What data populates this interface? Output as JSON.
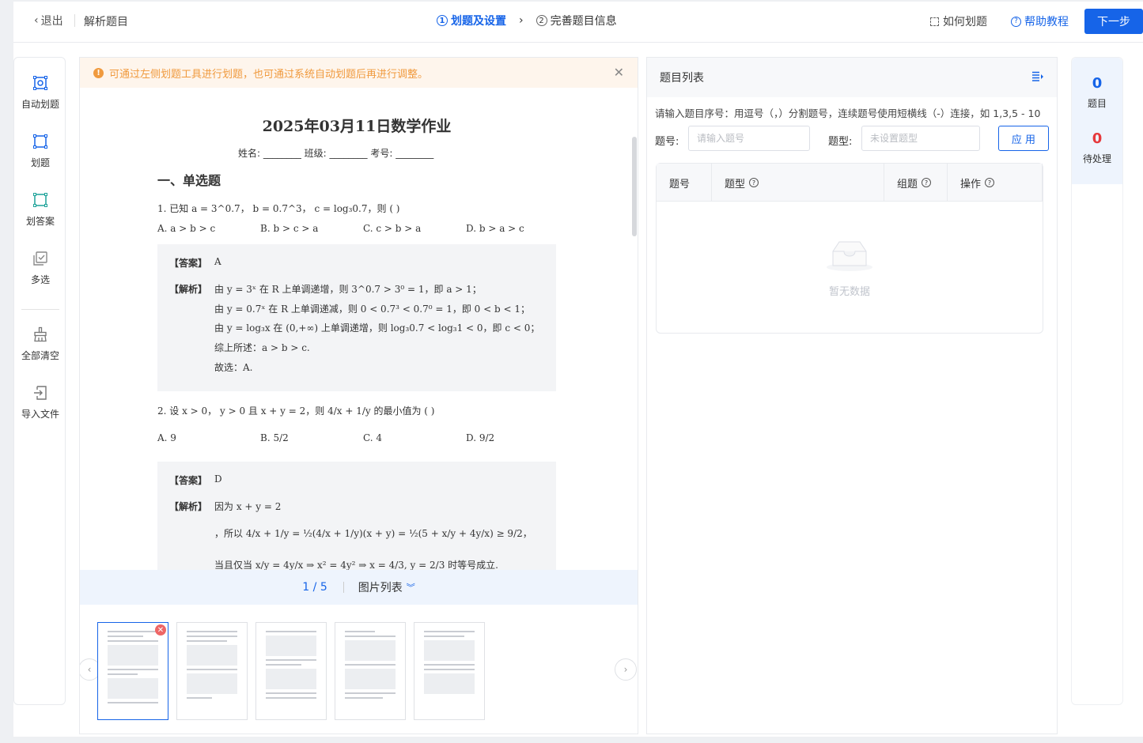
{
  "header": {
    "back_label": "退出",
    "title": "解析题目",
    "steps": [
      {
        "num": "1",
        "label": "划题及设置"
      },
      {
        "num": "2",
        "label": "完善题目信息"
      }
    ],
    "how_label": "如何划题",
    "help_label": "帮助教程",
    "next_label": "下一步"
  },
  "toolbar": {
    "items": [
      {
        "label": "自动划题",
        "icon": "auto-select-icon"
      },
      {
        "label": "划题",
        "icon": "select-question-icon"
      },
      {
        "label": "划答案",
        "icon": "select-answer-icon"
      },
      {
        "label": "多选",
        "icon": "multi-select-icon"
      },
      {
        "label": "全部清空",
        "icon": "broom-icon"
      },
      {
        "label": "导入文件",
        "icon": "import-icon"
      }
    ]
  },
  "notice": "可通过左侧划题工具进行划题，也可通过系统自动划题后再进行调整。",
  "document": {
    "title": "2025年03月11日数学作业",
    "fields": "姓名: ________  班级: ________  考号: ________",
    "section": "一、单选题",
    "q1": {
      "stem": "1. 已知 a = 3^0.7， b = 0.7^3， c = log₃0.7，则 ( )",
      "options": [
        "A. a > b > c",
        "B. b > c > a",
        "C. c > b > a",
        "D. b > a > c"
      ],
      "answer_label": "【答案】",
      "answer": "A",
      "analysis_label": "【解析】",
      "analysis": [
        "由 y = 3ˣ 在 R 上单调递增，则 3^0.7 > 3⁰ = 1，即 a > 1；",
        "由 y = 0.7ˣ 在 R 上单调递减，则 0 < 0.7³ < 0.7⁰ = 1，即 0 < b < 1；",
        "由 y = log₃x 在 (0,+∞) 上单调递增，则 log₃0.7 < log₃1 < 0，即 c < 0；",
        "综上所述：a > b > c.",
        "故选：A."
      ]
    },
    "q2": {
      "stem": "2. 设 x > 0， y > 0 且 x + y = 2，则 4/x + 1/y 的最小值为 ( )",
      "options": [
        "A. 9",
        "B. 5/2",
        "C. 4",
        "D. 9/2"
      ],
      "answer_label": "【答案】",
      "answer": "D",
      "analysis_label": "【解析】",
      "analysis": [
        "因为 x + y = 2",
        "，所以 4/x + 1/y = ½(4/x + 1/y)(x + y) = ½(5 + x/y + 4y/x) ≥ 9/2，",
        "当且仅当 x/y = 4y/x ⇒ x² = 4y² ⇒ x = 4/3, y = 2/3 时等号成立."
      ]
    }
  },
  "pager": {
    "current": "1",
    "total": "5",
    "separator": "/",
    "list_label": "图片列表"
  },
  "list_panel": {
    "title": "题目列表",
    "hint": "请输入题目序号：用逗号（，）分割题号，连续题号使用短横线（-）连接，如 1,3,5 - 10",
    "num_label": "题号:",
    "num_placeholder": "请输入题号",
    "type_label": "题型:",
    "type_placeholder": "未设置题型",
    "apply_label": "应 用",
    "columns": [
      "题号",
      "题型",
      "组题",
      "操作"
    ],
    "empty_text": "暂无数据"
  },
  "stats": {
    "questions_count": "0",
    "questions_label": "题目",
    "pending_count": "0",
    "pending_label": "待处理"
  },
  "colors": {
    "primary": "#1664e8",
    "warning": "#f09a3e",
    "danger": "#e6393c",
    "teal": "#1fa39a"
  }
}
